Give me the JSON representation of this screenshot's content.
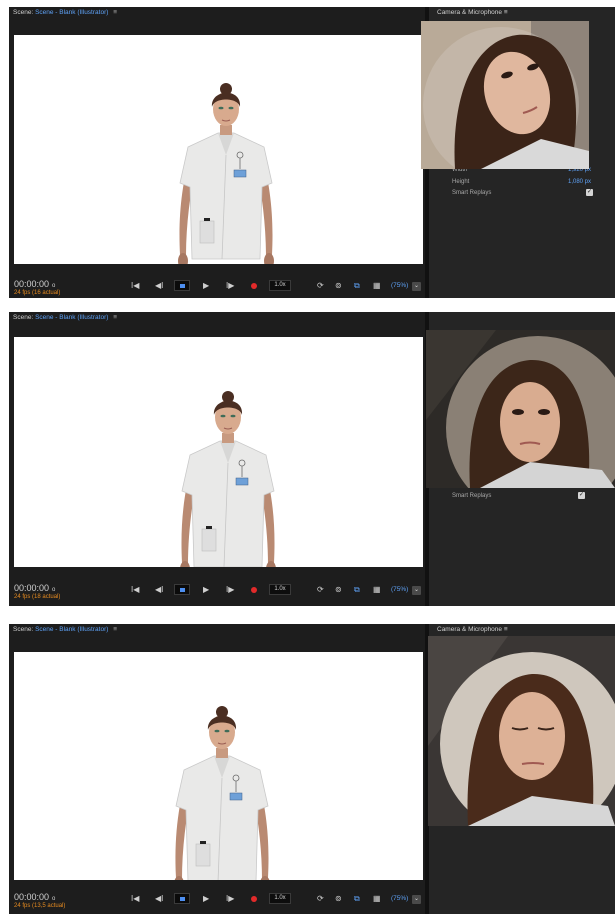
{
  "scene": {
    "prefix": "Scene:",
    "name": "Scene - Blank (Illustrator)",
    "menu_glyph": "≡"
  },
  "camera": {
    "title": "Camera & Microphone",
    "menu_glyph": "≡"
  },
  "properties": {
    "width_label": "Width",
    "width_value": "1,920 px",
    "height_label": "Height",
    "height_value": "1,080 px",
    "smart_replays_label": "Smart Replays",
    "check_glyph": "✓"
  },
  "controls": {
    "timecode": "00:00:00",
    "timecode_suffix": "o",
    "speed": "1.0x",
    "zoom": "(75%)",
    "zoom_arrow": "⌄",
    "skip_start_glyph": "I◀",
    "step_back_glyph": "◀I",
    "play_glyph": "▶",
    "step_forward_glyph": "I▶",
    "loop_glyph": "⟳",
    "calib_glyph": "⊚",
    "replay_glyph": "⧉",
    "grid_glyph": "▦"
  },
  "frames": [
    {
      "fps": "24 fps (16 actual)"
    },
    {
      "fps": "24 fps (18 actual)"
    },
    {
      "fps": "24 fps (13,5 actual)"
    }
  ],
  "colors": {
    "accent_blue": "#5ea1f5",
    "record_red": "#e22a2a",
    "fps_orange": "#e48a20",
    "panel_bg": "#1d1d1d"
  }
}
